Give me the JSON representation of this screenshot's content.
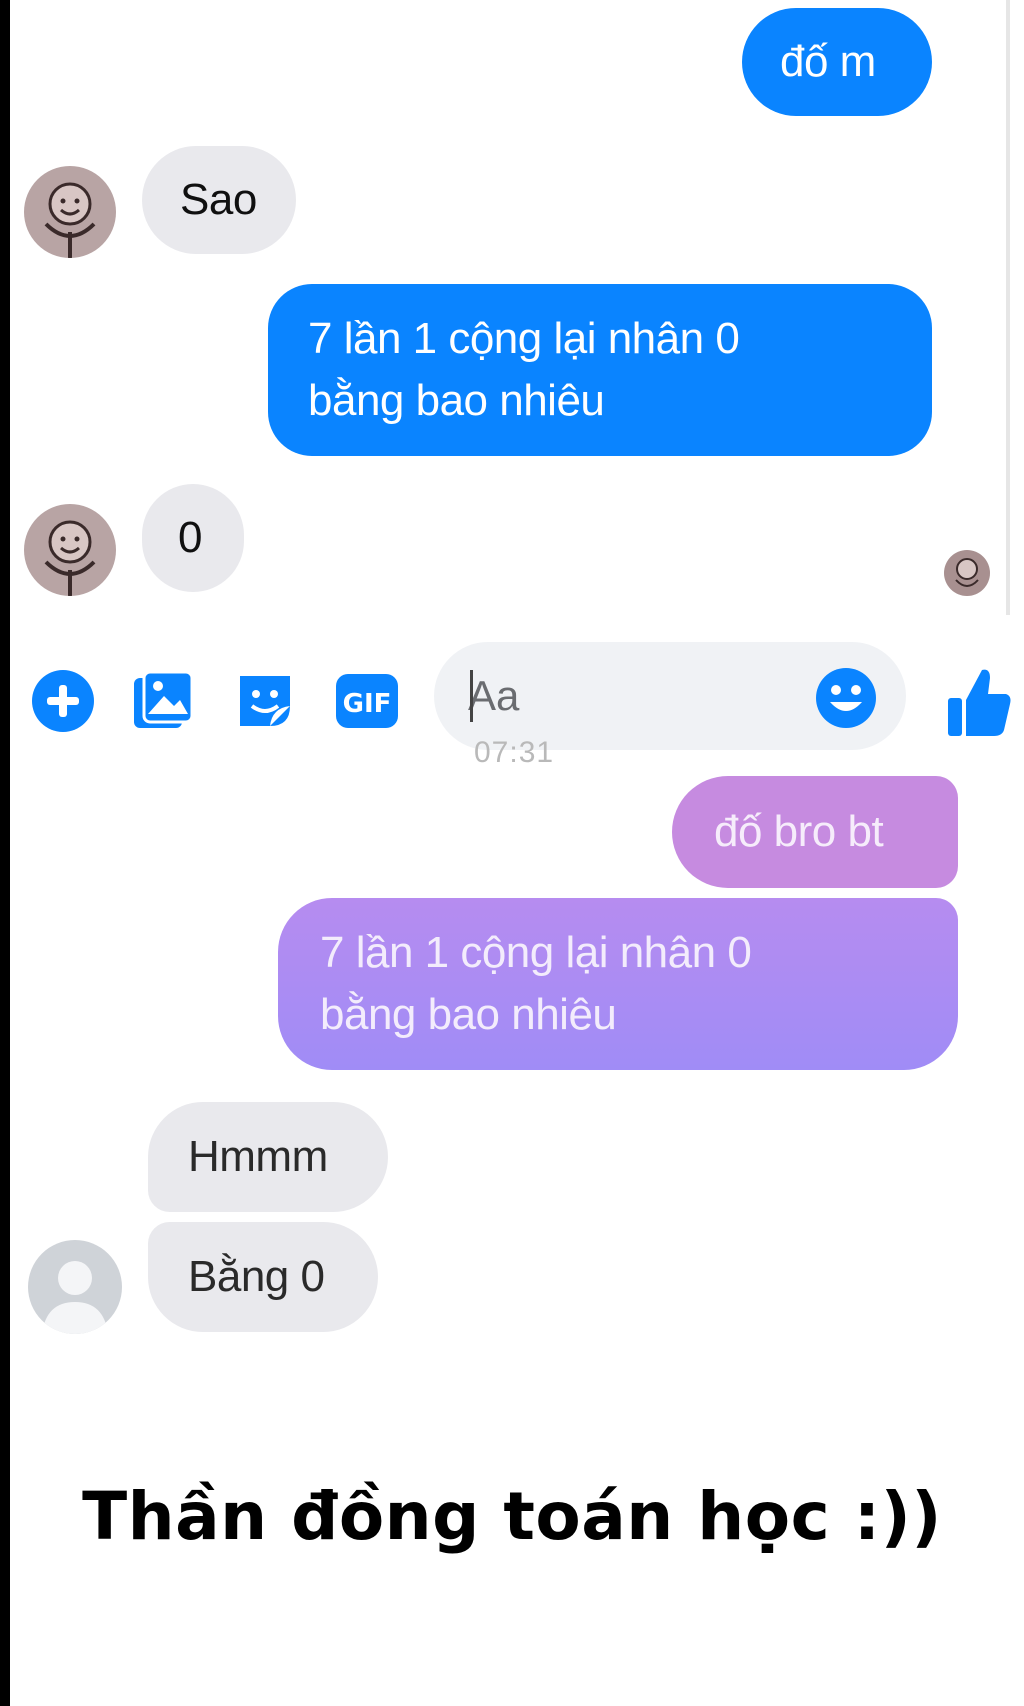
{
  "chat_top": {
    "messages": [
      {
        "sender": "me",
        "text": "đố m"
      },
      {
        "sender": "them",
        "text": "Sao"
      },
      {
        "sender": "me",
        "lines": [
          "7 lần 1 cộng lại nhân 0",
          "bằng bao nhiêu"
        ]
      },
      {
        "sender": "them",
        "text": "0"
      }
    ]
  },
  "composer": {
    "placeholder": "Aa",
    "icons": [
      "plus-icon",
      "photo-icon",
      "sticker-icon",
      "gif-icon",
      "emoji-icon",
      "like-icon"
    ],
    "gif_label": "GIF"
  },
  "timestamp": "07:31",
  "chat_bottom": {
    "messages": [
      {
        "sender": "me",
        "text": "đố bro bt"
      },
      {
        "sender": "me",
        "lines": [
          "7 lần 1 cộng lại nhân 0",
          "bằng bao nhiêu"
        ]
      },
      {
        "sender": "them",
        "text": "Hmmm"
      },
      {
        "sender": "them",
        "text": "Bằng 0"
      }
    ]
  },
  "caption": "Thần đồng toán học :))",
  "colors": {
    "sent_blue": "#0a84ff",
    "received_grey": "#e9e9ed",
    "sent_purple_light": "#c68be0",
    "sent_purple": "#a08cf6"
  }
}
